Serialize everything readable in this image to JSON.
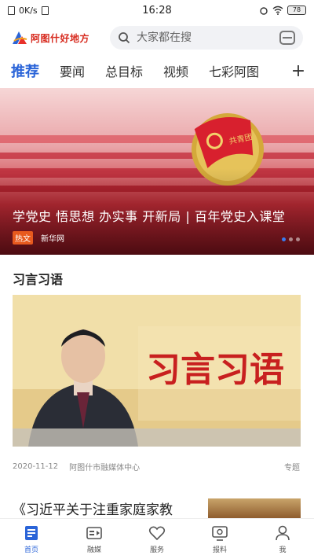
{
  "status_bar": {
    "network": "0K/s",
    "time": "16:28",
    "battery": "78"
  },
  "header": {
    "logo_text": "阿图什好地方",
    "search_placeholder": "大家都在搜"
  },
  "tabs": [
    {
      "label": "推荐",
      "active": true
    },
    {
      "label": "要闻",
      "active": false
    },
    {
      "label": "总目标",
      "active": false
    },
    {
      "label": "视频",
      "active": false
    },
    {
      "label": "七彩阿图",
      "active": false
    }
  ],
  "tabs_more": "+",
  "hero": {
    "title": "学党史 悟思想 办实事 开新局 | 百年党史入课堂",
    "tag": "热文",
    "source": "新华网",
    "badge_text": "共青团"
  },
  "section": {
    "title": "习言习语",
    "image_text": "习言习语",
    "date": "2020-11-12",
    "source": "阿图什市融媒体中心",
    "tag": "专题"
  },
  "next_article": {
    "title": "《习近平关于注重家庭家教"
  },
  "bottom_nav": [
    {
      "label": "首页",
      "icon": "home-icon",
      "active": true
    },
    {
      "label": "融媒",
      "icon": "media-icon",
      "active": false
    },
    {
      "label": "服务",
      "icon": "heart-service-icon",
      "active": false
    },
    {
      "label": "报料",
      "icon": "report-icon",
      "active": false
    },
    {
      "label": "我",
      "icon": "profile-icon",
      "active": false
    }
  ],
  "colors": {
    "accent": "#2a64d8",
    "brand_red": "#d72a1e",
    "hot_tag": "#e85a1e"
  }
}
